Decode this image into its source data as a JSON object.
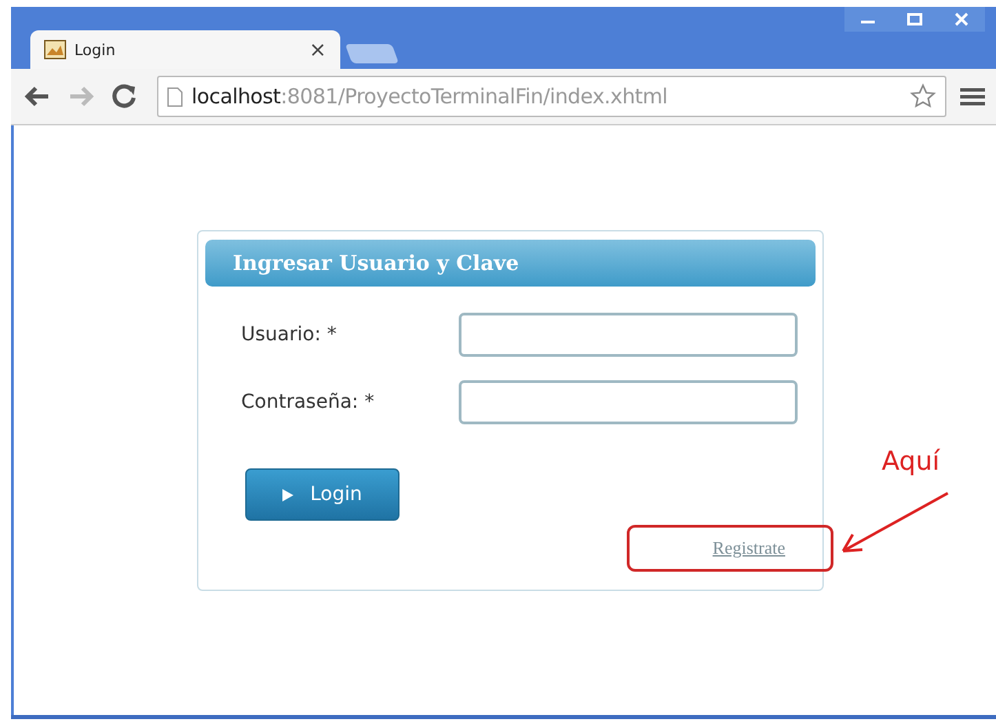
{
  "window": {
    "tab": {
      "title": "Login",
      "close": "×",
      "selected": true
    }
  },
  "address_bar": {
    "host": "localhost",
    "path": ":8081/ProyectoTerminalFin/index.xhtml"
  },
  "panel": {
    "title": "Ingresar Usuario y Clave",
    "fields": [
      {
        "label": "Usuario:",
        "required_mark": "*"
      },
      {
        "label": "Contraseña:",
        "required_mark": "*"
      }
    ],
    "button": "Login",
    "link": "Registrate"
  },
  "annotation": {
    "text": "Aquí"
  }
}
